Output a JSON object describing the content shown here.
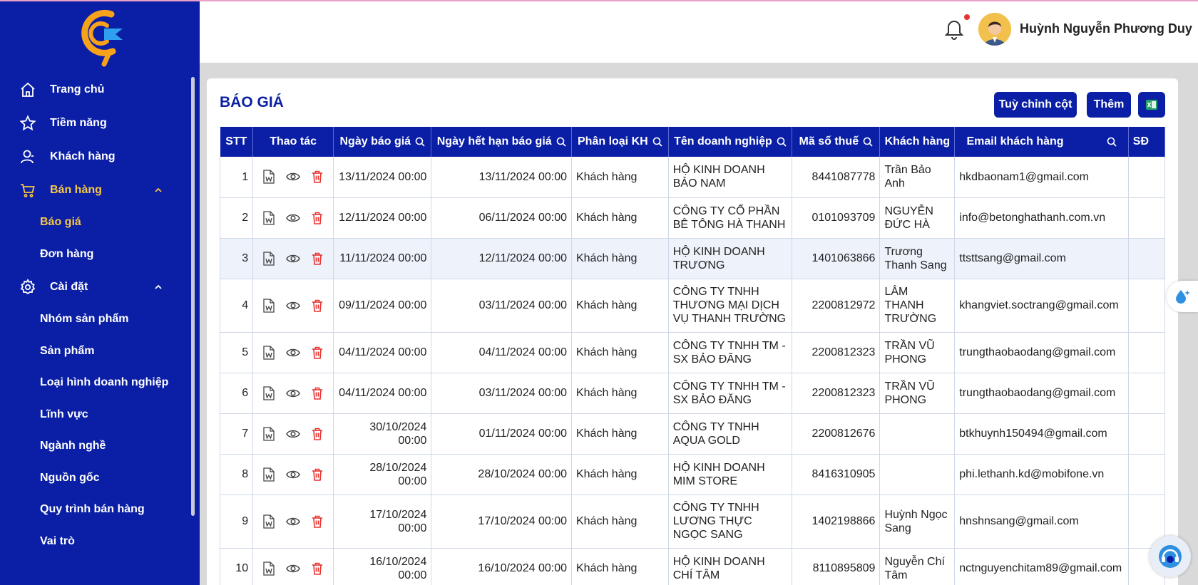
{
  "user": {
    "name": "Huỳnh Nguyễn Phương Duy"
  },
  "nav": {
    "home": "Trang chủ",
    "potential": "Tiềm năng",
    "customers": "Khách hàng",
    "sales": "Bán hàng",
    "sales_sub": {
      "quote": "Báo giá",
      "order": "Đơn hàng"
    },
    "settings": "Cài đặt",
    "settings_sub": {
      "product_group": "Nhóm sản phẩm",
      "product": "Sản phẩm",
      "business_type": "Loại hình doanh nghiệp",
      "field": "Lĩnh vực",
      "industry": "Ngành nghề",
      "source": "Nguồn gốc",
      "sales_process": "Quy trình bán hàng",
      "role": "Vai trò"
    }
  },
  "page": {
    "title": "BÁO GIÁ",
    "customize_columns_label": "Tuỳ chỉnh cột",
    "add_label": "Thêm"
  },
  "table": {
    "headers": {
      "stt": "STT",
      "actions": "Thao tác",
      "quote_date": "Ngày báo giá",
      "expiry_date": "Ngày hết hạn báo giá",
      "customer_type": "Phân loại KH",
      "company": "Tên doanh nghiệp",
      "tax_code": "Mã số thuế",
      "customer": "Khách hàng",
      "email": "Email khách hàng",
      "phone": "SĐ"
    },
    "rows": [
      {
        "stt": "1",
        "quote_date": "13/11/2024 00:00",
        "expiry_date": "13/11/2024 00:00",
        "customer_type": "Khách hàng",
        "company": "HỘ KINH DOANH BẢO NAM",
        "tax_code": "8441087778",
        "customer": "Trần Bảo Anh",
        "email": "hkdbaonam1@gmail.com"
      },
      {
        "stt": "2",
        "quote_date": "12/11/2024 00:00",
        "expiry_date": "06/11/2024 00:00",
        "customer_type": "Khách hàng",
        "company": "CÔNG TY CỔ PHẦN BÊ TÔNG HÀ THANH",
        "tax_code": "0101093709",
        "customer": "NGUYỄN ĐỨC HÀ",
        "email": "info@betonghathanh.com.vn"
      },
      {
        "stt": "3",
        "quote_date": "11/11/2024 00:00",
        "expiry_date": "12/11/2024 00:00",
        "customer_type": "Khách hàng",
        "company": "HỘ KINH DOANH TRƯƠNG",
        "tax_code": "1401063866",
        "customer": "Trương Thanh Sang",
        "email": "ttsttsang@gmail.com"
      },
      {
        "stt": "4",
        "quote_date": "09/11/2024 00:00",
        "expiry_date": "03/11/2024 00:00",
        "customer_type": "Khách hàng",
        "company": "CÔNG TY TNHH THƯƠNG MẠI DỊCH VỤ THANH TRƯỜNG",
        "tax_code": "2200812972",
        "customer": "LÂM THANH TRƯỜNG",
        "email": "khangviet.soctrang@gmail.com"
      },
      {
        "stt": "5",
        "quote_date": "04/11/2024 00:00",
        "expiry_date": "04/11/2024 00:00",
        "customer_type": "Khách hàng",
        "company": "CÔNG TY TNHH TM - SX BẢO ĐĂNG",
        "tax_code": "2200812323",
        "customer": "TRẦN VŨ PHONG",
        "email": "trungthaobaodang@gmail.com"
      },
      {
        "stt": "6",
        "quote_date": "04/11/2024 00:00",
        "expiry_date": "03/11/2024 00:00",
        "customer_type": "Khách hàng",
        "company": "CÔNG TY TNHH TM - SX BẢO ĐĂNG",
        "tax_code": "2200812323",
        "customer": "TRẦN VŨ PHONG",
        "email": "trungthaobaodang@gmail.com"
      },
      {
        "stt": "7",
        "quote_date": "30/10/2024 00:00",
        "expiry_date": "01/11/2024 00:00",
        "customer_type": "Khách hàng",
        "company": "CÔNG TY TNHH AQUA GOLD",
        "tax_code": "2200812676",
        "customer": "",
        "email": "btkhuynh150494@gmail.com"
      },
      {
        "stt": "8",
        "quote_date": "28/10/2024 00:00",
        "expiry_date": "28/10/2024 00:00",
        "customer_type": "Khách hàng",
        "company": "HỘ KINH DOANH MIM STORE",
        "tax_code": "8416310905",
        "customer": "",
        "email": "phi.lethanh.kd@mobifone.vn"
      },
      {
        "stt": "9",
        "quote_date": "17/10/2024 00:00",
        "expiry_date": "17/10/2024 00:00",
        "customer_type": "Khách hàng",
        "company": "CÔNG TY TNHH LƯƠNG THỰC NGỌC SANG",
        "tax_code": "1402198866",
        "customer": "Huỳnh Ngọc Sang",
        "email": "hnshnsang@gmail.com"
      },
      {
        "stt": "10",
        "quote_date": "16/10/2024 00:00",
        "expiry_date": "16/10/2024 00:00",
        "customer_type": "Khách hàng",
        "company": "HỘ KINH DOANH CHÍ TÂM",
        "tax_code": "8110895809",
        "customer": "Nguyễn Chí Tâm",
        "email": "nctnguyenchitam89@gmail.com"
      }
    ]
  },
  "icons": {
    "word": "word-file-icon",
    "view": "eye-icon",
    "delete": "trash-icon",
    "search": "search-icon"
  },
  "colors": {
    "primary": "#0a1fa5",
    "active": "#f7c744",
    "danger": "#e8322f"
  }
}
